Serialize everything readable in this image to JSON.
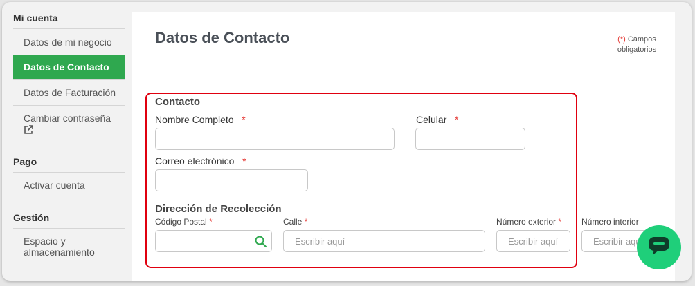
{
  "sidebar": {
    "sections": [
      {
        "label": "Mi cuenta"
      },
      {
        "label": "Pago"
      },
      {
        "label": "Gestión"
      }
    ],
    "items": [
      {
        "label": "Datos de mi negocio"
      },
      {
        "label": "Datos de Contacto"
      },
      {
        "label": "Datos de Facturación"
      },
      {
        "label": "Cambiar contraseña"
      },
      {
        "label": "Activar cuenta"
      },
      {
        "label": "Espacio y almacenamiento"
      }
    ],
    "active_item": "Datos de Contacto",
    "icons": {
      "external_link": "external-link-icon"
    }
  },
  "main": {
    "title": "Datos de Contacto",
    "required_note": {
      "marker": "(*)",
      "text": " Campos obligatorios"
    }
  },
  "contact": {
    "title": "Contacto",
    "full_name": {
      "label": "Nombre Completo",
      "required": "*",
      "value": ""
    },
    "phone": {
      "label": "Celular",
      "required": "*",
      "value": ""
    },
    "email": {
      "label": "Correo electrónico",
      "required": "*",
      "value": ""
    }
  },
  "pickup": {
    "title": "Dirección de Recolección",
    "postal_code": {
      "label": "Código Postal",
      "required": "*",
      "value": "",
      "icon": "search-icon"
    },
    "street": {
      "label": "Calle",
      "required": "*",
      "placeholder": "Escribir aquí"
    },
    "ext_number": {
      "label": "Número exterior",
      "required": "*",
      "placeholder": "Escribir aquí"
    },
    "int_number": {
      "label": "Número interior",
      "placeholder": "Escribir aquí"
    }
  },
  "colors": {
    "accent": "#2fa84f",
    "required": "#e53935",
    "highlight_box": "#e0000f",
    "chat": "#1fcf7a"
  },
  "chat_button": {
    "icon": "chat-bubble-icon"
  }
}
